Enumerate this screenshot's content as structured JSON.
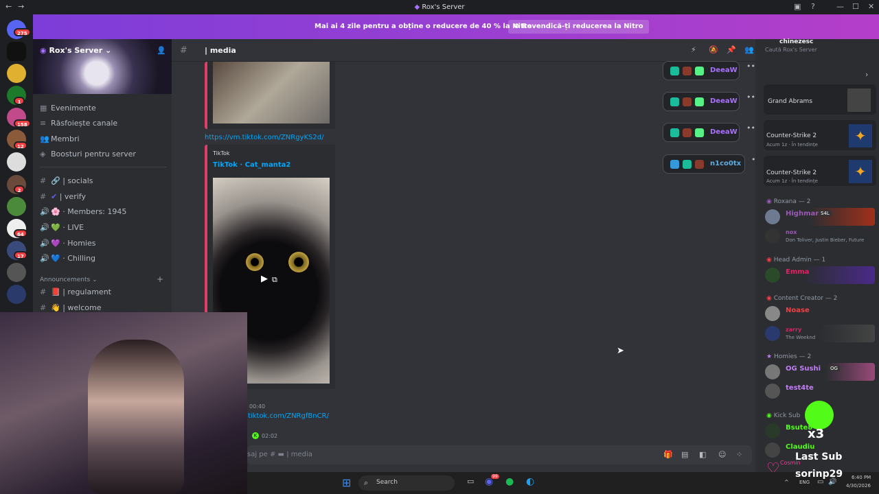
{
  "window": {
    "title": "Rox's Server"
  },
  "banner": {
    "message": "Mai ai 4 zile pentru a obține o reducere de 40 % la Nitro",
    "button": "Revendică-ți reducerea la Nitro"
  },
  "guilds": {
    "badges": [
      "275",
      "1",
      "158",
      "12",
      "2",
      "64",
      "17"
    ]
  },
  "server": {
    "name": "Rox's Server",
    "nav": [
      "Evenimente",
      "Răsfoiește canale",
      "Membri",
      "Boosturi pentru server"
    ],
    "channels": [
      {
        "prefix": "#",
        "emoji": "🔗",
        "label": "| socials"
      },
      {
        "prefix": "#",
        "emoji": "✔",
        "label": "| verify"
      },
      {
        "prefix": "🔊",
        "emoji": "🌸",
        "label": "· Members: 1945"
      },
      {
        "prefix": "🔊",
        "emoji": "💚",
        "label": "· LIVE"
      },
      {
        "prefix": "🔊",
        "emoji": "💜",
        "label": "· Homies"
      },
      {
        "prefix": "🔊",
        "emoji": "💙",
        "label": "· Chilling"
      }
    ],
    "category": "Announcements",
    "announce_channels": [
      {
        "prefix": "#",
        "emoji": "📕",
        "label": "| regulament"
      },
      {
        "prefix": "#",
        "emoji": "👋",
        "label": "| welcome"
      }
    ]
  },
  "chat": {
    "channel": "| media",
    "link1": "https://vm.tiktok.com/ZNRgyKS2d/",
    "embed_provider": "TikTok",
    "embed_title": "TikTok · Cat_manta2",
    "time1": "00:40",
    "link2": "tiktok.com/ZNRgfBnCR/",
    "time2": "02:02",
    "input_placeholder": "saj pe #",
    "input_channel": "| media"
  },
  "voice_pills": [
    "DeeaW",
    "DeeaW",
    "DeeaW",
    "n1co0tx"
  ],
  "members": {
    "search_placeholder": "Caută Rox's Server",
    "top_name": "chinezesc",
    "activities": [
      {
        "name": "Grand Abrams",
        "sub": ""
      },
      {
        "name": "Counter-Strike 2",
        "sub": "Acum 1z · În tendințe"
      },
      {
        "name": "Counter-Strike 2",
        "sub": "Acum 1z · În tendințe"
      }
    ],
    "groups": [
      {
        "title": "Roxana — 2",
        "members": [
          {
            "name": "Highman",
            "sub": "",
            "color": "#9b59b6",
            "tag": "S4L"
          },
          {
            "name": "nox",
            "sub": "Don Toliver, Justin Bieber, Future",
            "color": "#9b59b6",
            "tag": ""
          }
        ]
      },
      {
        "title": "Head Admin — 1",
        "members": [
          {
            "name": "Emma",
            "sub": "",
            "color": "#e91e63",
            "tag": ""
          }
        ]
      },
      {
        "title": "Content Creator — 2",
        "members": [
          {
            "name": "Noase",
            "sub": "",
            "color": "#f23f43",
            "tag": ""
          },
          {
            "name": "zarry",
            "sub": "The Weeknd",
            "color": "#e91e63",
            "tag": ""
          }
        ]
      },
      {
        "title": "Homies — 2",
        "members": [
          {
            "name": "OG Sushi",
            "sub": "",
            "color": "#c27cf7",
            "tag": "OG"
          },
          {
            "name": "test4te",
            "sub": "",
            "color": "#c27cf7",
            "tag": ""
          }
        ]
      },
      {
        "title": "Kick Sub",
        "members": [
          {
            "name": "Bsute8",
            "sub": "",
            "color": "#53fc18",
            "tag": ""
          },
          {
            "name": "Claudiu",
            "sub": "",
            "color": "#53fc18",
            "tag": ""
          }
        ]
      }
    ]
  },
  "overlay": {
    "multiplier": "x3",
    "label": "Last Sub",
    "user": "sorinp29",
    "small": "Cosmin"
  },
  "taskbar": {
    "search": "Search",
    "lang": "ENG",
    "time": "6:40 PM",
    "date": "4/30/2026",
    "discord_badge": "99"
  },
  "colors": {
    "accent": "#5865f2",
    "nitro": "#8e44e0",
    "link": "#00a8fc",
    "embed_border": "#e03e66"
  }
}
